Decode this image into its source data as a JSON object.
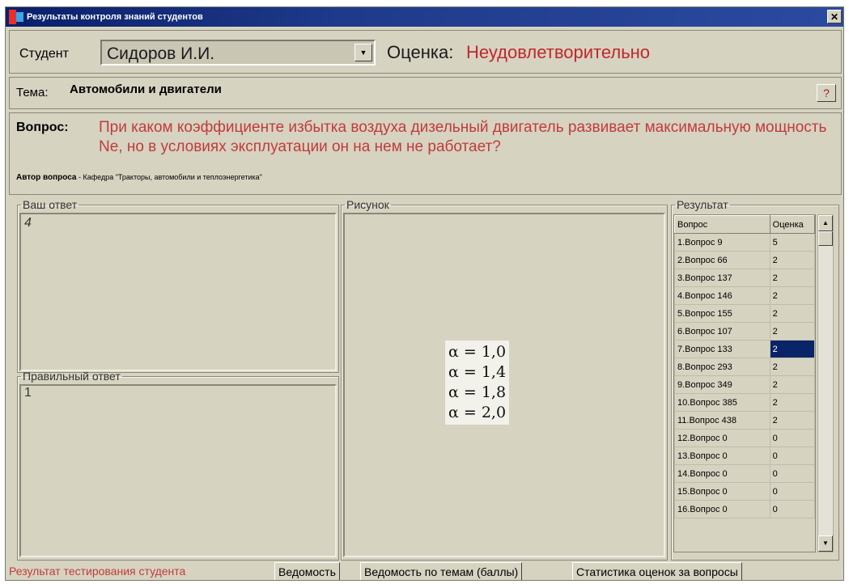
{
  "window": {
    "title": "Результаты контроля знаний студентов",
    "close_glyph": "✕"
  },
  "student": {
    "label": "Студент",
    "value": "Сидоров И.И."
  },
  "grade": {
    "label": "Оценка:",
    "value": "Неудовлетворительно"
  },
  "topic": {
    "label": "Тема:",
    "value": "Автомобили и двигатели",
    "help_glyph": "?"
  },
  "question": {
    "label": "Вопрос:",
    "text": "При каком коэффициенте избытка воздуха дизельный двигатель развивает максимальную мощность Ne, но в условиях эксплуатации он на нем не работает?",
    "author_label": "Автор вопроса",
    "author_value": " - Кафедра \"Тракторы, автомобили и теплоэнергетика\""
  },
  "your_answer": {
    "legend": "Ваш ответ",
    "value": "4"
  },
  "correct_answer": {
    "legend": "Правильный ответ",
    "value": "1"
  },
  "picture": {
    "legend": "Рисунок",
    "formula_lines": [
      "α = 1,0",
      "α = 1,4",
      "α = 1,8",
      "α = 2,0"
    ]
  },
  "results": {
    "legend": "Результат",
    "columns": [
      "Вопрос",
      "Оценка"
    ],
    "rows": [
      {
        "q": "1.Вопрос 9",
        "g": "5"
      },
      {
        "q": "2.Вопрос 66",
        "g": "2"
      },
      {
        "q": "3.Вопрос 137",
        "g": "2"
      },
      {
        "q": "4.Вопрос 146",
        "g": "2"
      },
      {
        "q": "5.Вопрос 155",
        "g": "2"
      },
      {
        "q": "6.Вопрос 107",
        "g": "2"
      },
      {
        "q": "7.Вопрос 133",
        "g": "2"
      },
      {
        "q": "8.Вопрос 293",
        "g": "2"
      },
      {
        "q": "9.Вопрос 349",
        "g": "2"
      },
      {
        "q": "10.Вопрос 385",
        "g": "2"
      },
      {
        "q": "11.Вопрос 438",
        "g": "2"
      },
      {
        "q": "12.Вопрос 0",
        "g": "0"
      },
      {
        "q": "13.Вопрос 0",
        "g": "0"
      },
      {
        "q": "14.Вопрос 0",
        "g": "0"
      },
      {
        "q": "15.Вопрос 0",
        "g": "0"
      },
      {
        "q": "16.Вопрос 0",
        "g": "0"
      }
    ],
    "selected_row": 6
  },
  "tabs": [
    {
      "label": "Результат тестирования студента",
      "active": true
    },
    {
      "label": "Ведомость",
      "active": false
    },
    {
      "label": "Ведомость по темам (баллы)",
      "active": false
    },
    {
      "label": "Статистика оценок за вопросы",
      "active": false
    }
  ],
  "colors": {
    "title_bar": "#0a1f6b",
    "accent_red": "#c23b3b",
    "face": "#d6d3c1",
    "selection": "#0a246a"
  },
  "icons": {
    "dropdown": "chevron-down-icon",
    "scroll_up": "arrow-up-icon",
    "scroll_down": "arrow-down-icon"
  }
}
